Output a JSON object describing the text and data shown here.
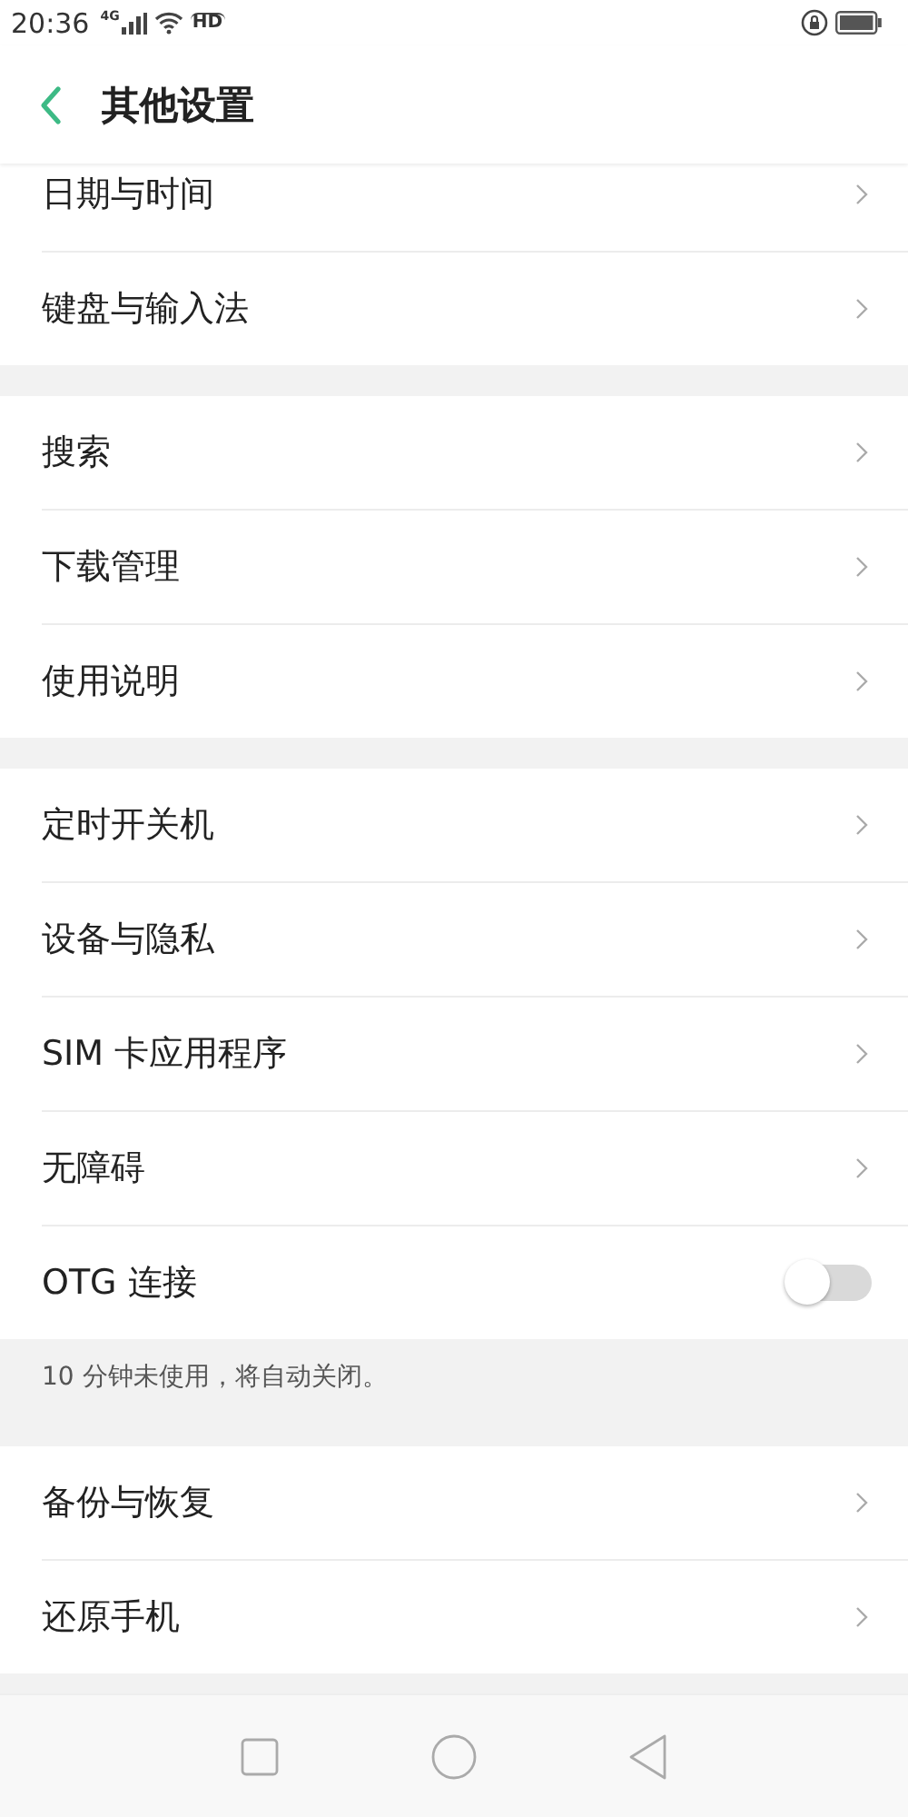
{
  "status_bar": {
    "time": "20:36",
    "network": "4G",
    "hd": "HD"
  },
  "header": {
    "title": "其他设置"
  },
  "groups": [
    {
      "items": [
        {
          "kind": "link",
          "label": "日期与时间"
        },
        {
          "kind": "link",
          "label": "键盘与输入法"
        }
      ]
    },
    {
      "items": [
        {
          "kind": "link",
          "label": "搜索"
        },
        {
          "kind": "link",
          "label": "下载管理"
        },
        {
          "kind": "link",
          "label": "使用说明"
        }
      ]
    },
    {
      "items": [
        {
          "kind": "link",
          "label": "定时开关机"
        },
        {
          "kind": "link",
          "label": "设备与隐私"
        },
        {
          "kind": "link",
          "label": "SIM 卡应用程序"
        },
        {
          "kind": "link",
          "label": "无障碍"
        },
        {
          "kind": "toggle",
          "label": "OTG 连接",
          "on": false
        }
      ],
      "footer": "10 分钟未使用，将自动关闭。"
    },
    {
      "items": [
        {
          "kind": "link",
          "label": "备份与恢复"
        },
        {
          "kind": "link",
          "label": "还原手机"
        }
      ]
    }
  ]
}
